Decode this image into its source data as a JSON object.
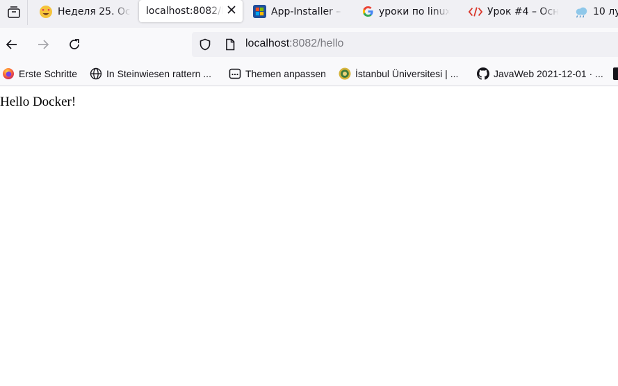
{
  "tabs": [
    {
      "label": "Неделя 25. Осн",
      "icon": "heart-eyes-emoji-icon",
      "active": false
    },
    {
      "label": "localhost:8082/h",
      "icon": "",
      "active": true
    },
    {
      "label": "App-Installer –",
      "icon": "windows-store-icon",
      "active": false
    },
    {
      "label": "уроки по linux",
      "icon": "google-icon",
      "active": false
    },
    {
      "label": "Урок #4 – Осно",
      "icon": "code-icon",
      "active": false
    },
    {
      "label": "10 лу",
      "icon": "weather-icon",
      "active": false
    }
  ],
  "address_bar": {
    "host": "localhost",
    "rest": ":8082/hello"
  },
  "bookmarks": [
    {
      "label": "Erste Schritte",
      "icon": "firefox-icon"
    },
    {
      "label": "In Steinwiesen rattern ...",
      "icon": "globe-icon"
    },
    {
      "label": "Themen anpassen",
      "icon": "addons-icon"
    },
    {
      "label": "İstanbul Üniversitesi | ...",
      "icon": "university-seal-icon"
    },
    {
      "label": "JavaWeb 2021-12-01 · ...",
      "icon": "github-icon"
    }
  ],
  "page": {
    "text": "Hello Docker!"
  },
  "colors": {
    "tab_strip_bg": "#f0f0f4",
    "toolbar_bg": "#f9f9fb",
    "url_gray": "#7a7a80"
  }
}
